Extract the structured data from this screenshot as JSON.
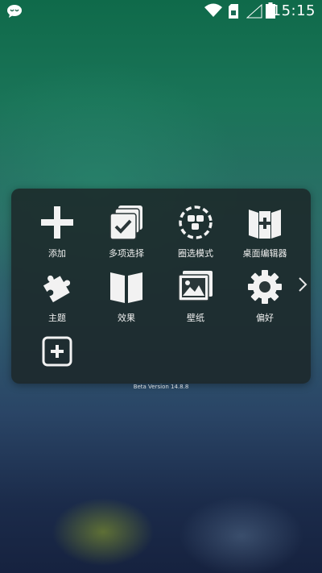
{
  "status_bar": {
    "time": "15:15",
    "icons": [
      "chat-icon",
      "wifi-icon",
      "sim-card-icon",
      "signal-icon",
      "battery-icon"
    ]
  },
  "menu": {
    "items": [
      {
        "label": "添加",
        "icon": "plus-icon"
      },
      {
        "label": "多项选择",
        "icon": "multi-select-icon"
      },
      {
        "label": "圈选模式",
        "icon": "lasso-select-icon"
      },
      {
        "label": "桌面编辑器",
        "icon": "desktop-editor-icon"
      },
      {
        "label": "主题",
        "icon": "puzzle-icon"
      },
      {
        "label": "效果",
        "icon": "effects-book-icon"
      },
      {
        "label": "壁纸",
        "icon": "wallpaper-icon"
      },
      {
        "label": "偏好",
        "icon": "gear-icon"
      },
      {
        "label": "",
        "icon": "add-box-icon"
      }
    ],
    "next_page_icon": "chevron-right-icon"
  },
  "version_text": "Beta Version 14.8.8",
  "colors": {
    "panel_bg": "#1c2628",
    "icon_color": "#f2f2f2",
    "check_color": "#2a3638"
  }
}
